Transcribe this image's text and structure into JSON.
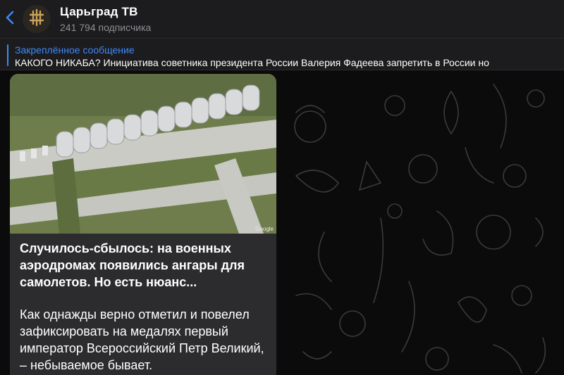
{
  "header": {
    "title": "Царьград ТВ",
    "subscribers": "241 794 подписчика",
    "back_icon": "chevron-left-icon",
    "avatar_icon": "channel-logo-cross-icon",
    "accent_color": "#3e88f7"
  },
  "pinned": {
    "title": "Закреплённое сообщение",
    "text": "КАКОГО НИКАБА?   Инициатива советника президента России Валерия Фадеева запретить в России но"
  },
  "message": {
    "photo_watermark": "Google",
    "heading": "Случилось-сбылось: на военных аэродромах появились ангары для самолетов. Но есть нюанс...",
    "body": "Как однажды верно отметил и повелел зафиксировать на медалях первый император Всероссийский Петр Великий, – небываемое бывает."
  }
}
